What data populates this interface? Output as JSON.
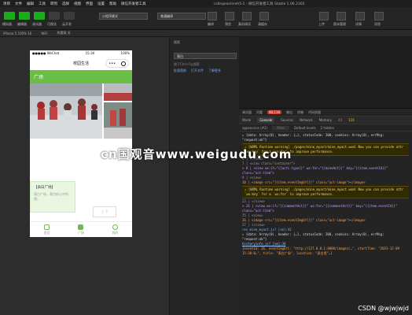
{
  "menubar": {
    "items": [
      "项目",
      "文件",
      "编辑",
      "工具",
      "转到",
      "选择",
      "视图",
      "界面",
      "设置",
      "帮助",
      "微信开发者工具"
    ],
    "window_title": "collegeonlineh5-1 - 微信开发者工具 Stable 1.06.2303"
  },
  "toolbar": {
    "left_buttons": [
      "模拟器",
      "编辑器",
      "调试器",
      "可视化",
      "云开发"
    ],
    "mode_select": "小程序模式",
    "compile_select": "普通编译",
    "center_buttons": [
      "编译",
      "预览",
      "真机调试",
      "清缓存"
    ],
    "right_buttons": [
      "上传",
      "版本管理",
      "详情",
      "消息"
    ]
  },
  "subbar": {
    "device": "iPhone 5 100% 16",
    "network": "WiFi",
    "hot_reload": "热重载 关"
  },
  "phone": {
    "status_time": "15:30",
    "status_left": "●●●●● WeChat",
    "status_battery": "100%",
    "nav_title": "校园生活",
    "capsule_dots": "•••",
    "header_title": "广场",
    "card_title": "【表白广场】",
    "card_desc": "表白广场，表白你心中所想。",
    "float_button": "上 下",
    "tabs": [
      {
        "label": "首页",
        "active": false
      },
      {
        "label": "广场",
        "active": true
      },
      {
        "label": "我的",
        "active": false
      }
    ]
  },
  "panel": {
    "search_label": "搜索",
    "search_value": "表白",
    "links": [
      "批量替换",
      "打开文件",
      "了解更多"
    ],
    "hint": "按下Ctrl+F以搜索"
  },
  "devtools": {
    "tabs1": [
      "调试器",
      "问题",
      "输出",
      "终端",
      "代码质量"
    ],
    "badge": "40,116",
    "tabs2": [
      "Wxml",
      "Console",
      "Sources",
      "Network",
      "Memory",
      "AppData",
      "Storage"
    ],
    "errors_label": "40",
    "warnings_label": "116",
    "filter_context": "appservice (#2)",
    "filter_placeholder": "Filter",
    "levels": "Default levels",
    "hidden": "2 hidden",
    "lines": [
      {
        "kind": "plain",
        "text": "▸ {data: Array(0), header: {…}, statusCode: 200, cookies: Array(0), errMsg: \"request:ok\"}"
      },
      {
        "kind": "warn",
        "text": "⚠ [WXML Runtime warning] ./pages/mine_myact/mine_myact.wxml Now you can provide attr `wx:key` for a `wx:for` to improve performance."
      },
      {
        "kind": "code",
        "text": "  6 | </view>"
      },
      {
        "kind": "code",
        "text": "  7 | <view class=\"container\">"
      },
      {
        "kind": "code",
        "text": "> 8 | <view wx:if=\"{{acti.type}}\" wx:for=\"{{mineAct}}\" key=\"{{item.eventId}}\" class=\"act-item\">"
      },
      {
        "kind": "code",
        "text": "  9 |   <view>"
      },
      {
        "kind": "code",
        "text": " 10 |     <image src=\"{{item.eventImgUrl}}\" class=\"act-image\"></image>"
      },
      {
        "kind": "warn",
        "text": "⚠ [WXML Runtime warning] ./pages/mine_myact/mine_myact.wxml Now you can provide attr `wx:key` for a `wx:for` to improve performance."
      },
      {
        "kind": "code",
        "text": " 23 | </view>"
      },
      {
        "kind": "code",
        "text": "> 24 | <view wx:if=\"{{commentAct}}\" wx:for=\"{{commentAct}}\" key=\"{{item.eventId}}\" class=\"act-item\">"
      },
      {
        "kind": "code",
        "text": " 25 |   <view>"
      },
      {
        "kind": "code",
        "text": " 26 |     <image src=\"{{item.eventImgUrl}}\" class=\"act-image\"></image>"
      },
      {
        "kind": "code",
        "text": " 27 |   </view>"
      },
      {
        "kind": "plain",
        "text": "res                                          mine_myact.js? [sm]:42"
      },
      {
        "kind": "plain",
        "text": "▸ {data: Array(0), header: {…}, statusCode: 200, cookies: Array(0), errMsg: \"request:ok\"}"
      },
      {
        "kind": "plain",
        "text": "                                             historyinfo.js? [sm]:34"
      },
      {
        "kind": "plain",
        "text": "{eventId: 26, eventImgUrl: \"http://127.0.0.1:8080/images/…\", startTime: \"2023-12-09 15:30:0…\", title: \"表白广场\", location: \"表白墙\"…}"
      }
    ]
  },
  "watermark": "cn国观音www.weigudu.com",
  "credit": "CSDN @wjwjwjd",
  "colors": {
    "brand_green": "#1aad19",
    "header_green": "#6abd45",
    "error_badge": "#c0392b",
    "warn_bg": "#332b00"
  }
}
